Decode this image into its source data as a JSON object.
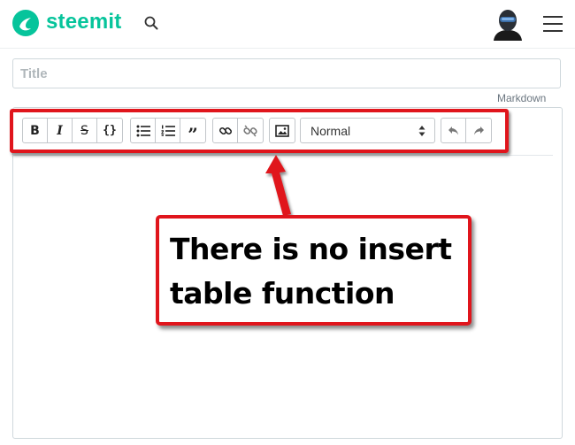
{
  "header": {
    "brand": "steemit",
    "brand_color": "#06c49b"
  },
  "icons": {
    "logo": "steemit-logo-icon",
    "search": "search-icon",
    "avatar": "user-avatar",
    "menu": "hamburger-menu-icon"
  },
  "editor": {
    "title_placeholder": "Title",
    "markdown_label": "Markdown",
    "format_select_value": "Normal",
    "toolbar": {
      "bold": "B",
      "italic": "I",
      "strike": "S",
      "code": "{}",
      "quote": "”"
    }
  },
  "annotation": {
    "callout_line1": "There is no insert",
    "callout_line2": "table function",
    "highlight_color": "#e0151c"
  }
}
